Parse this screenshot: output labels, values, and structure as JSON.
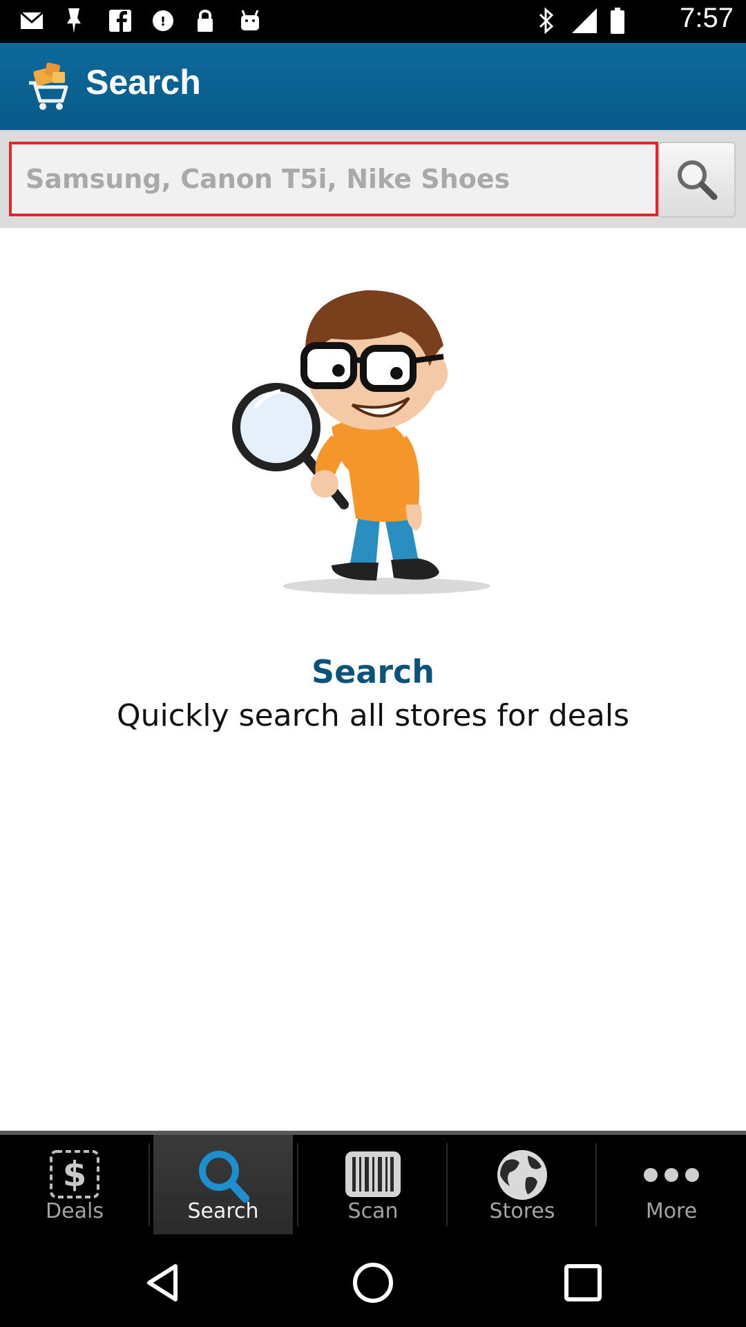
{
  "status_bar": {
    "time": "7:57",
    "left_icons": [
      "mail-icon",
      "pin-icon",
      "facebook-icon",
      "deal-icon",
      "lock-icon",
      "android-icon"
    ],
    "right_icons": [
      "bluetooth-icon",
      "signal-icon",
      "battery-icon"
    ]
  },
  "header": {
    "title": "Search",
    "logo_icon": "shopping-cart-logo-icon",
    "color": "#0b6491"
  },
  "search": {
    "placeholder": "Samsung, Canon T5i, Nike Shoes",
    "value": "",
    "focus_border_color": "#e0262d",
    "button_icon": "magnifier-icon"
  },
  "empty_state": {
    "illustration": "boy-with-magnifier-illustration",
    "title": "Search",
    "subtitle": "Quickly search all stores for deals"
  },
  "tabs": [
    {
      "label": "Deals",
      "icon": "dollar-tag-icon",
      "active": false
    },
    {
      "label": "Search",
      "icon": "search-icon",
      "active": true
    },
    {
      "label": "Scan",
      "icon": "barcode-icon",
      "active": false
    },
    {
      "label": "Stores",
      "icon": "globe-icon",
      "active": false
    },
    {
      "label": "More",
      "icon": "more-dots-icon",
      "active": false
    }
  ],
  "nav": [
    "back-icon",
    "home-icon",
    "recent-apps-icon"
  ]
}
